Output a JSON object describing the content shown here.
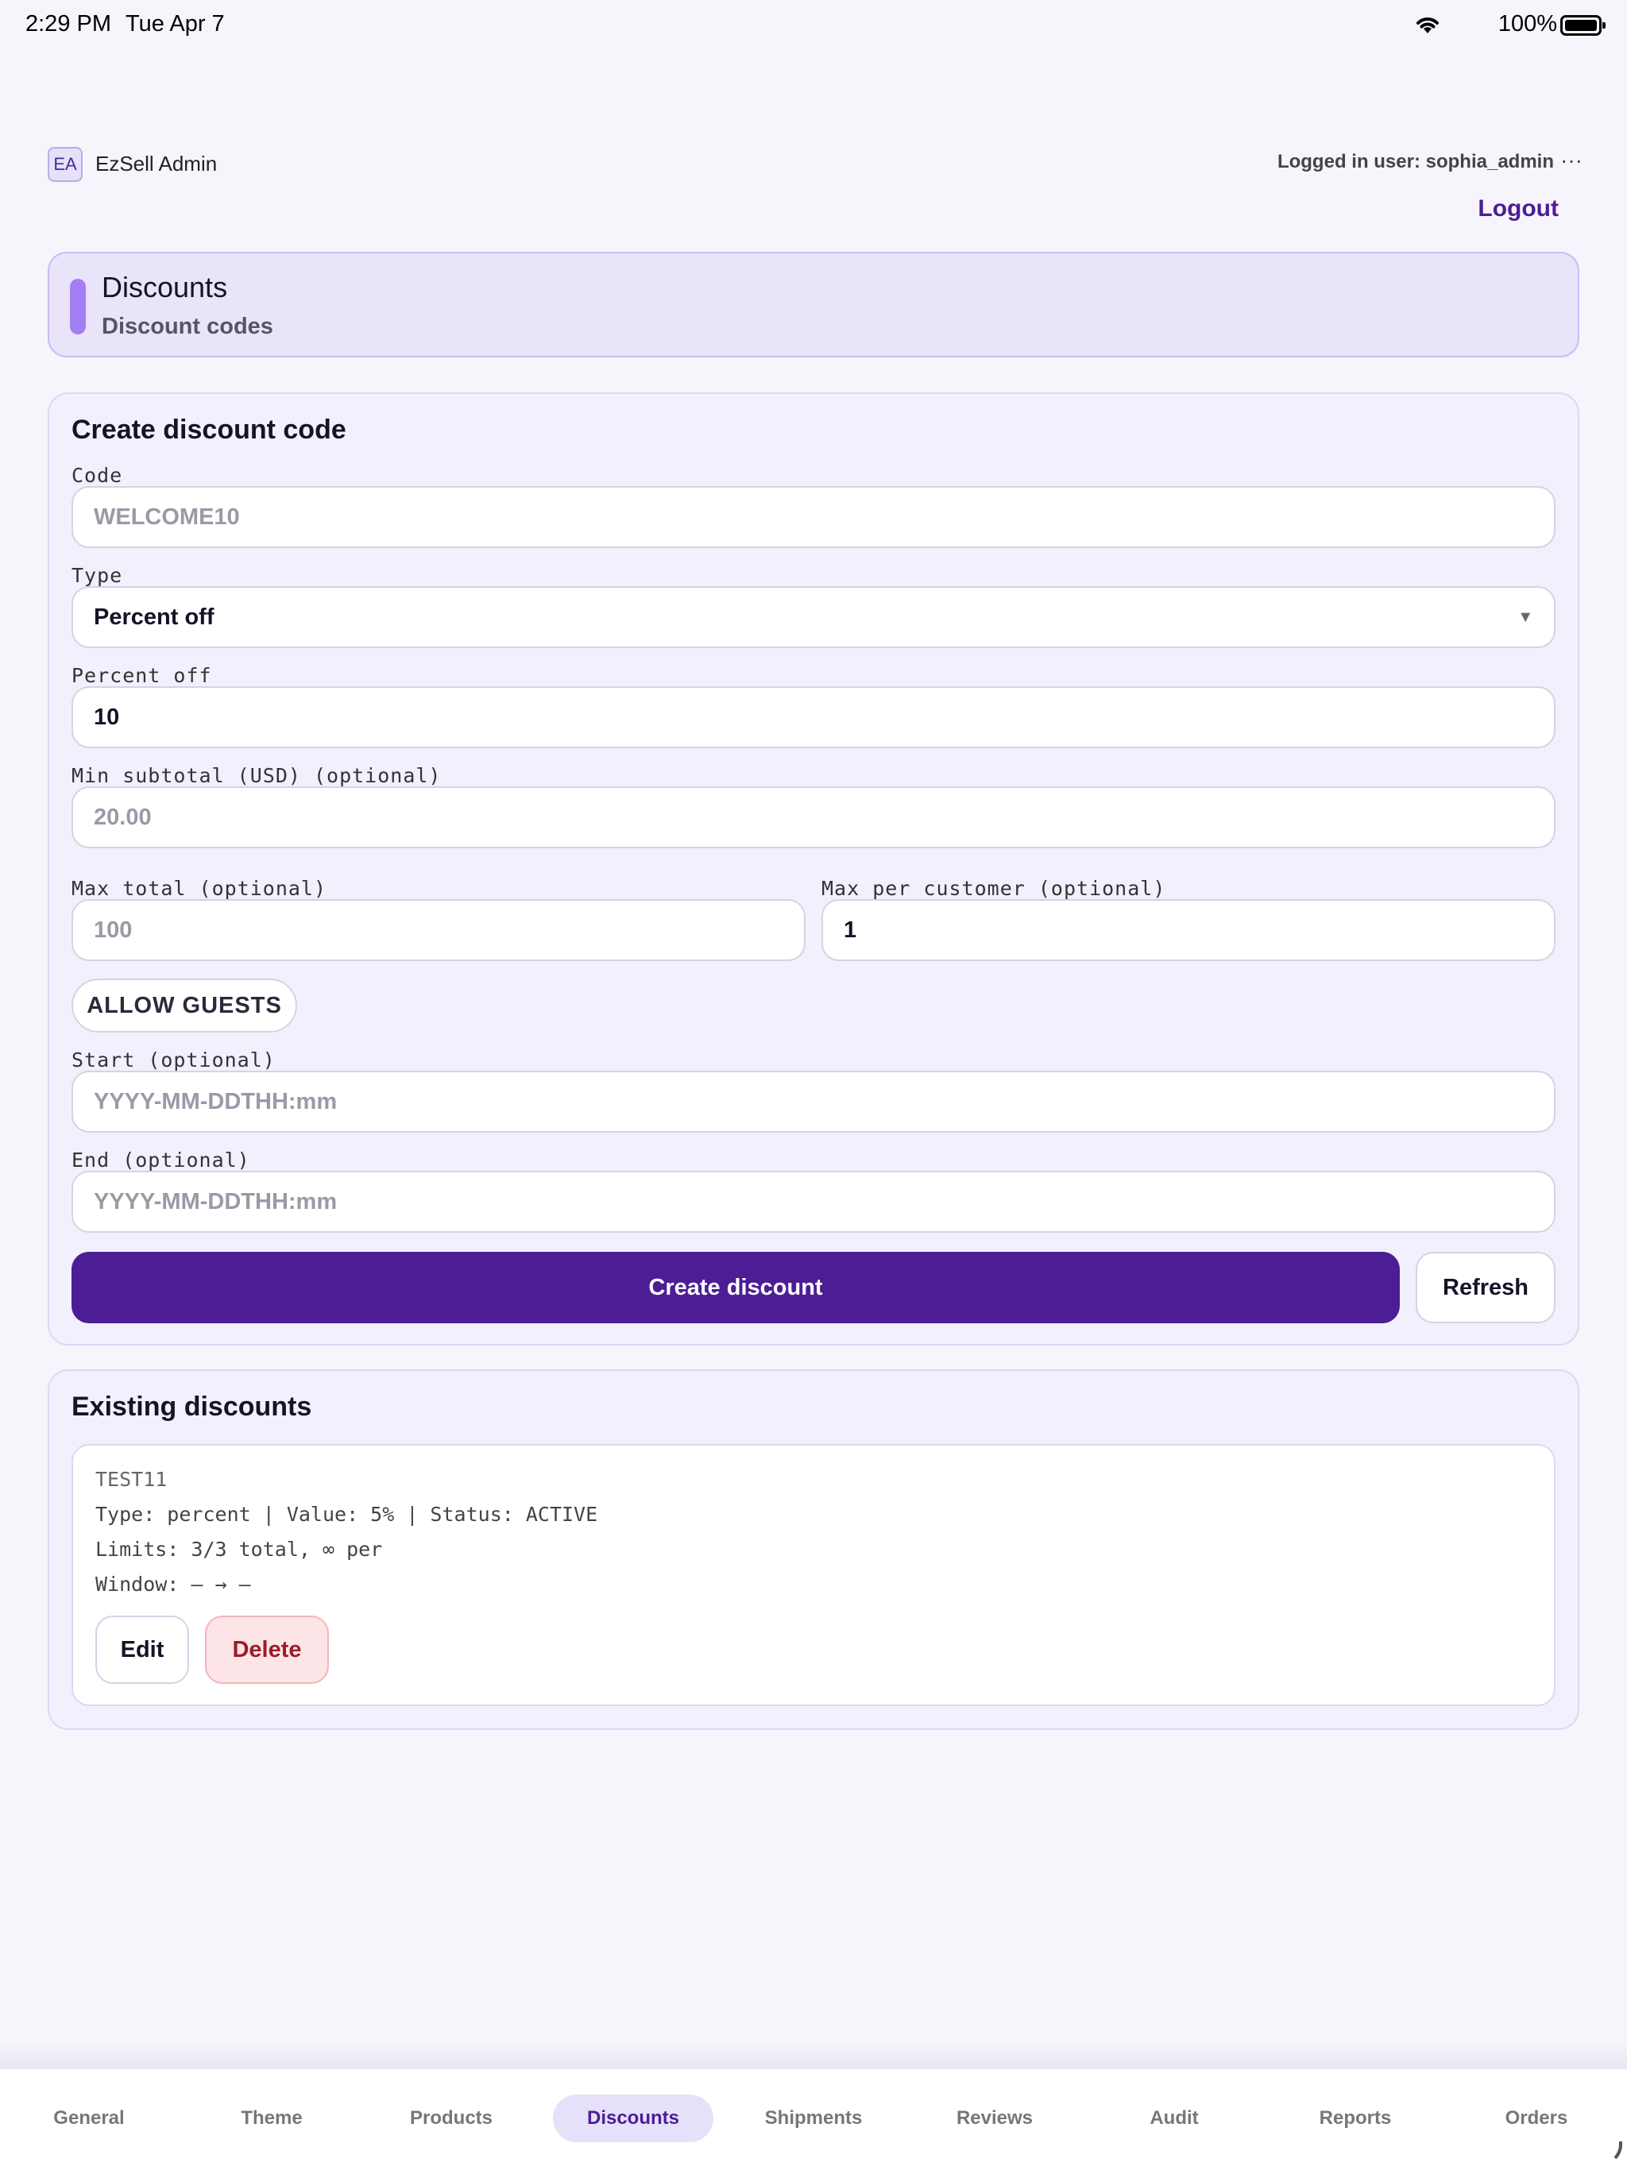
{
  "status_bar": {
    "time": "2:29 PM",
    "date": "Tue Apr 7",
    "battery": "100%"
  },
  "header": {
    "avatar_initials": "EA",
    "app_title": "EzSell Admin",
    "user_info": "Logged in user: sophia_admin",
    "more": "···",
    "logout": "Logout"
  },
  "banner": {
    "title": "Discounts",
    "subtitle": "Discount codes"
  },
  "create": {
    "title": "Create discount code",
    "code_label": "Code",
    "code_placeholder": "WELCOME10",
    "type_label": "Type",
    "type_value": "Percent off",
    "percent_label": "Percent off",
    "percent_value": "10",
    "min_subtotal_label": "Min subtotal (USD) (optional)",
    "min_subtotal_placeholder": "20.00",
    "max_total_label": "Max total (optional)",
    "max_total_placeholder": "100",
    "max_per_customer_label": "Max per customer (optional)",
    "max_per_customer_value": "1",
    "allow_guests": "ALLOW GUESTS",
    "start_label": "Start (optional)",
    "start_placeholder": "YYYY-MM-DDTHH:mm",
    "end_label": "End (optional)",
    "end_placeholder": "YYYY-MM-DDTHH:mm",
    "create_button": "Create discount",
    "refresh_button": "Refresh"
  },
  "existing": {
    "title": "Existing discounts",
    "items": [
      {
        "code": "TEST11",
        "details": "Type: percent | Value: 5% | Status: ACTIVE",
        "limits": "Limits: 3/3 total, ∞ per",
        "window": "Window: — → —",
        "edit": "Edit",
        "delete": "Delete"
      }
    ]
  },
  "tabs": [
    {
      "label": "General",
      "active": false
    },
    {
      "label": "Theme",
      "active": false
    },
    {
      "label": "Products",
      "active": false
    },
    {
      "label": "Discounts",
      "active": true
    },
    {
      "label": "Shipments",
      "active": false
    },
    {
      "label": "Reviews",
      "active": false
    },
    {
      "label": "Audit",
      "active": false
    },
    {
      "label": "Reports",
      "active": false
    },
    {
      "label": "Orders",
      "active": false
    }
  ],
  "colors": {
    "accent": "#4c1d95",
    "banner_bg": "#e9e4fa",
    "delete": "#9b1c2a"
  }
}
